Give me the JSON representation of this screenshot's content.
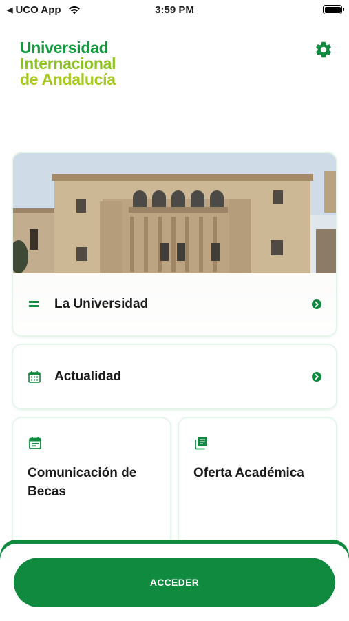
{
  "status_bar": {
    "back_app": "UCO App",
    "time": "3:59 PM"
  },
  "header": {
    "logo_lines": [
      "Universidad",
      "Internacional",
      "de Andalucía"
    ]
  },
  "cards": {
    "universidad": {
      "label": "La Universidad",
      "icon": "menu-lines-icon"
    },
    "actualidad": {
      "label": "Actualidad",
      "icon": "calendar-icon"
    },
    "becas": {
      "label": "Comunicación de Becas",
      "icon": "event-note-icon"
    },
    "oferta": {
      "label": "Oferta Académica",
      "icon": "library-books-icon"
    }
  },
  "footer": {
    "button_label": "ACCEDER"
  },
  "colors": {
    "brand_green": "#0f8a3f",
    "logo_green": "#0f9a3d",
    "logo_lime": "#8cc21e"
  }
}
